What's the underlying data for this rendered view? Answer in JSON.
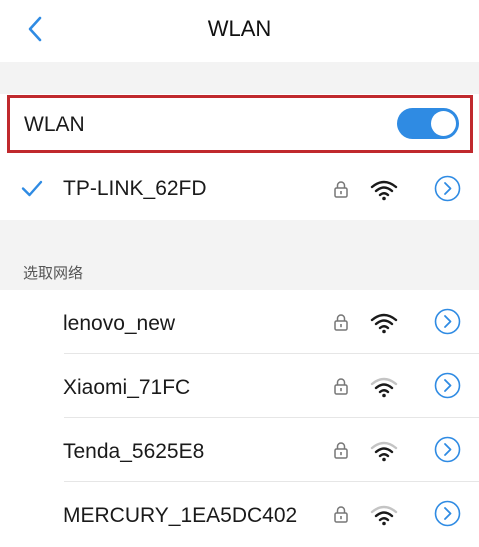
{
  "header": {
    "title": "WLAN",
    "back_icon": "chevron-left-icon"
  },
  "wlan_toggle": {
    "label": "WLAN",
    "state": "on",
    "accent": "#2f8be3",
    "highlight_color": "#c0292d"
  },
  "connected": {
    "name": "TP-LINK_62FD",
    "status_icon": "check-icon"
  },
  "section_title": "选取网络",
  "networks": [
    {
      "name": "lenovo_new",
      "signal": "strong"
    },
    {
      "name": "Xiaomi_71FC",
      "signal": "medium"
    },
    {
      "name": "Tenda_5625E8",
      "signal": "medium"
    },
    {
      "name": "MERCURY_1EA5DC402",
      "signal": "medium"
    }
  ]
}
